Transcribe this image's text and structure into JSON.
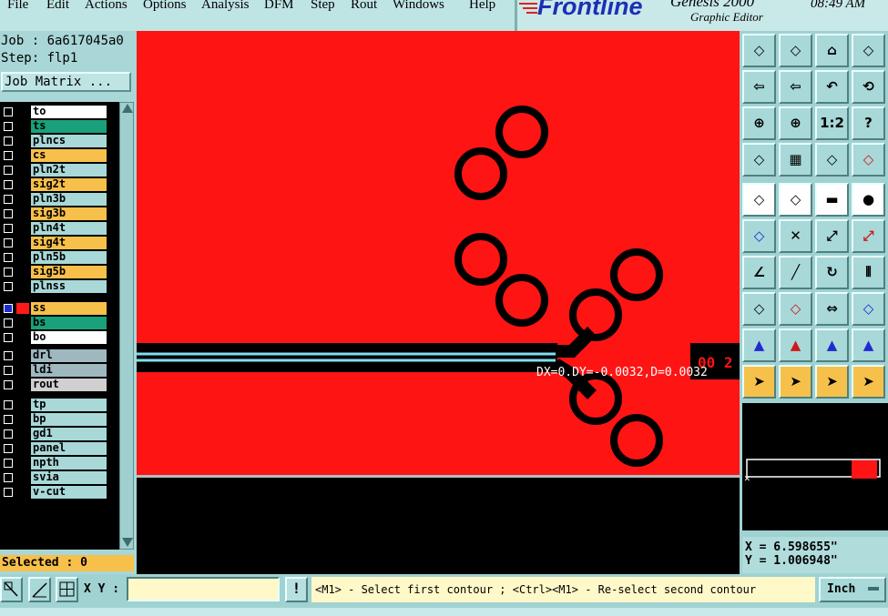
{
  "menubar": {
    "items": [
      "File",
      "Edit",
      "Actions",
      "Options",
      "Analysis",
      "DFM",
      "Step",
      "Rout",
      "Windows",
      "Help"
    ]
  },
  "brand": {
    "logo": "Frontline",
    "title": "Genesis 2000",
    "subtitle": "Graphic Editor",
    "clock": "08:49 AM"
  },
  "job": {
    "job_line": "Job : 6a617045a0",
    "step_line": "Step: flp1",
    "matrix_button": "Job Matrix ..."
  },
  "layers": [
    {
      "name": "to",
      "color": "#ffffff",
      "selected": false,
      "group": 0
    },
    {
      "name": "ts",
      "color": "#1aa07a",
      "selected": false,
      "group": 0
    },
    {
      "name": "plncs",
      "color": "#a9d8d8",
      "selected": false,
      "group": 0
    },
    {
      "name": "cs",
      "color": "#f7c04a",
      "selected": false,
      "group": 0
    },
    {
      "name": "pln2t",
      "color": "#a9d8d8",
      "selected": false,
      "group": 0
    },
    {
      "name": "sig2t",
      "color": "#f7c04a",
      "selected": false,
      "group": 0
    },
    {
      "name": "pln3b",
      "color": "#a9d8d8",
      "selected": false,
      "group": 0
    },
    {
      "name": "sig3b",
      "color": "#f7c04a",
      "selected": false,
      "group": 0
    },
    {
      "name": "pln4t",
      "color": "#a9d8d8",
      "selected": false,
      "group": 0
    },
    {
      "name": "sig4t",
      "color": "#f7c04a",
      "selected": false,
      "group": 0
    },
    {
      "name": "pln5b",
      "color": "#a9d8d8",
      "selected": false,
      "group": 0
    },
    {
      "name": "sig5b",
      "color": "#f7c04a",
      "selected": false,
      "group": 0
    },
    {
      "name": "plnss",
      "color": "#a9d8d8",
      "selected": false,
      "group": 0
    },
    {
      "name": "ss",
      "color": "#f7c04a",
      "selected": true,
      "group": 1
    },
    {
      "name": "bs",
      "color": "#1aa07a",
      "selected": false,
      "group": 1
    },
    {
      "name": "bo",
      "color": "#ffffff",
      "selected": false,
      "group": 1
    },
    {
      "name": "drl",
      "color": "#9fb8c0",
      "selected": false,
      "group": 2
    },
    {
      "name": "ldi",
      "color": "#9fb8c0",
      "selected": false,
      "group": 2
    },
    {
      "name": "rout",
      "color": "#d0d0d0",
      "selected": false,
      "group": 2
    },
    {
      "name": "tp",
      "color": "#a9d8d8",
      "selected": false,
      "group": 3
    },
    {
      "name": "bp",
      "color": "#a9d8d8",
      "selected": false,
      "group": 3
    },
    {
      "name": "gd1",
      "color": "#a9d8d8",
      "selected": false,
      "group": 3
    },
    {
      "name": "panel",
      "color": "#a9d8d8",
      "selected": false,
      "group": 3
    },
    {
      "name": "npth",
      "color": "#a9d8d8",
      "selected": false,
      "group": 3
    },
    {
      "name": "svia",
      "color": "#a9d8d8",
      "selected": false,
      "group": 3
    },
    {
      "name": "v-cut",
      "color": "#a9d8d8",
      "selected": false,
      "group": 3
    }
  ],
  "selected_count": "Selected : 0",
  "canvas": {
    "measure_text": "DX=0.DY=-0.0032,D=0.0032",
    "board_color": "#ff1414",
    "trace_color": "#7fe0f0"
  },
  "tools": [
    "select-layer-icon",
    "view-layer-icon",
    "home-icon",
    "split-window-icon",
    "pan-left-icon",
    "pan-right-icon",
    "undo-icon",
    "snap-icon",
    "zoom-fit-icon",
    "zoom-center-icon",
    "ratio-1-2-icon",
    "help-icon",
    "settings-icon",
    "grid-icon",
    "measure-pad-icon",
    "measure-pad-red-icon",
    "add-pad-icon",
    "polygon-icon",
    "ruler-icon",
    "pad-icon",
    "connect-icon",
    "delete-icon",
    "move-point-icon",
    "move-point-red-icon",
    "angle-icon",
    "line-icon",
    "rotate-icon",
    "mirror-icon",
    "pad-snap-icon",
    "line-red-icon",
    "resize-icon",
    "pads-blue-icon",
    "drc-triangle-icon",
    "drc-triangle-red-icon",
    "drc-triangle-blue-icon",
    "drc-triangle-cross-icon",
    "pointer-icon",
    "pointer-box-icon",
    "pointer-shape-icon",
    "pointer-net-icon"
  ],
  "coords": {
    "x": "X = 6.598655\"",
    "y": "Y = 1.006948\""
  },
  "bottom": {
    "xy_label": "X Y :",
    "xy_value": "",
    "warning": "!",
    "status": "<M1> - Select first contour ; <Ctrl><M1> - Re-select second contour",
    "unit": "Inch"
  }
}
